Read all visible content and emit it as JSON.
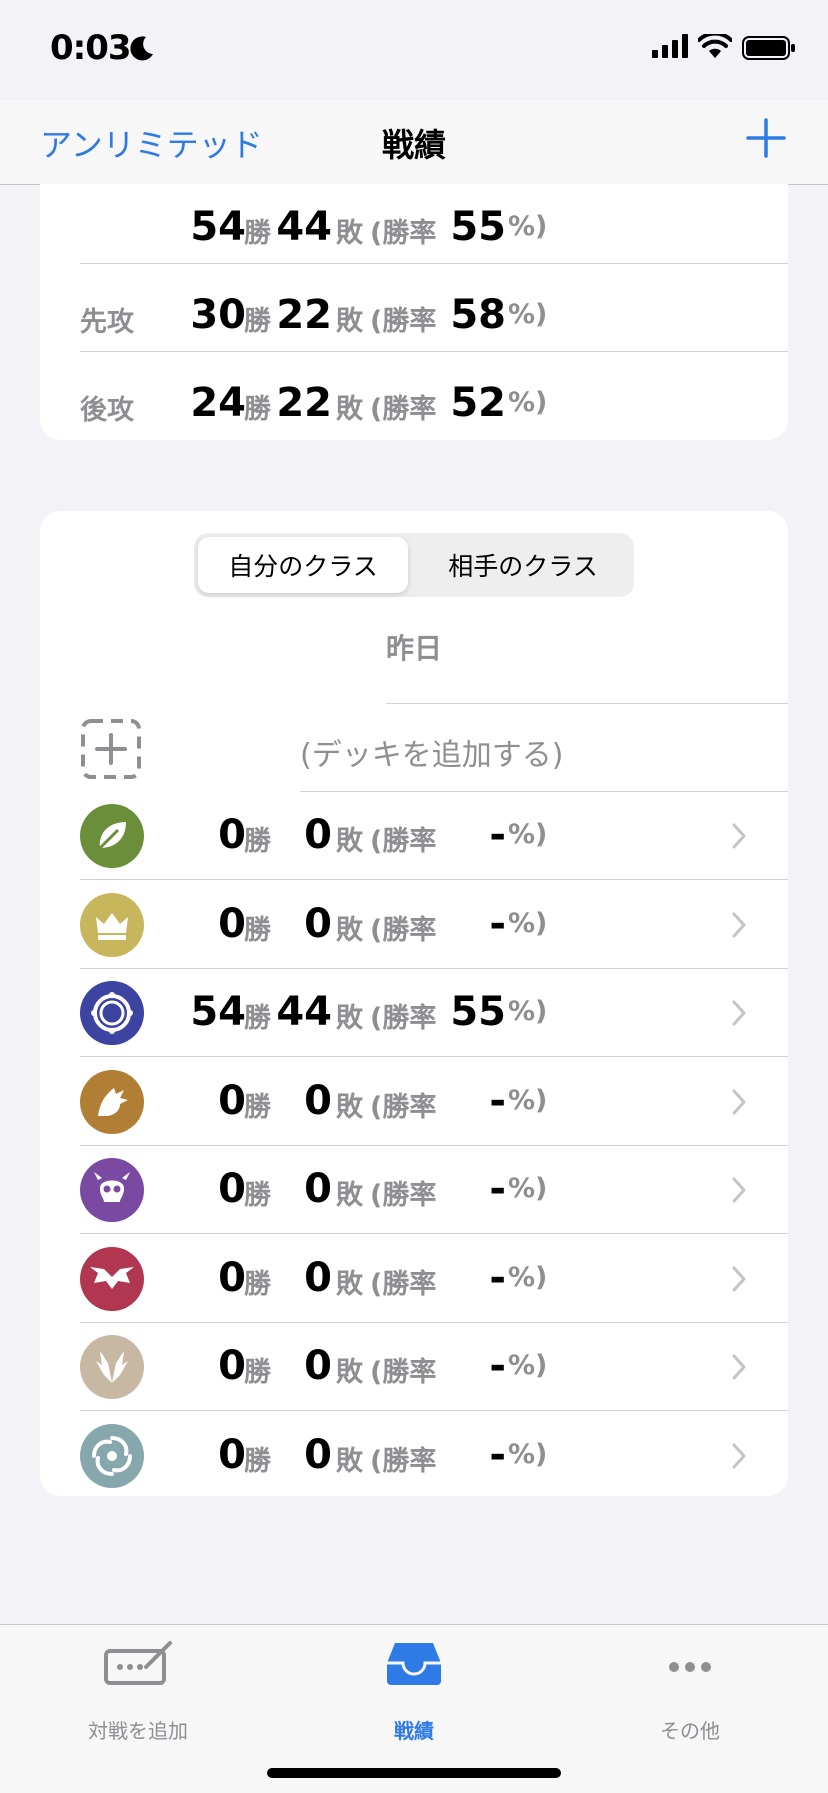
{
  "status": {
    "time": "0:03"
  },
  "nav": {
    "back_label": "アンリミテッド",
    "title": "戦績"
  },
  "summary": {
    "rows": [
      {
        "label": "",
        "wins": "54",
        "win_unit": "勝",
        "losses": "44",
        "loss_unit": "敗",
        "rate_prefix": "(勝率",
        "rate": "55",
        "rate_suffix": "%)"
      },
      {
        "label": "先攻",
        "wins": "30",
        "win_unit": "勝",
        "losses": "22",
        "loss_unit": "敗",
        "rate_prefix": "(勝率",
        "rate": "58",
        "rate_suffix": "%)"
      },
      {
        "label": "後攻",
        "wins": "24",
        "win_unit": "勝",
        "losses": "22",
        "loss_unit": "敗",
        "rate_prefix": "(勝率",
        "rate": "52",
        "rate_suffix": "%)"
      }
    ]
  },
  "segment": {
    "options": [
      "自分のクラス",
      "相手のクラス"
    ],
    "selected": 0
  },
  "section": {
    "header": "昨日",
    "add_deck": "(デッキを追加する)"
  },
  "classes": [
    {
      "icon": "forest-leaf-icon",
      "color": "#6b8e3a",
      "wins": "0",
      "losses": "0",
      "rate": "-"
    },
    {
      "icon": "sword-crown-icon",
      "color": "#c7b65b",
      "wins": "0",
      "losses": "0",
      "rate": "-"
    },
    {
      "icon": "rune-circle-icon",
      "color": "#3d43a0",
      "wins": "54",
      "losses": "44",
      "rate": "55"
    },
    {
      "icon": "dragon-icon",
      "color": "#b07f35",
      "wins": "0",
      "losses": "0",
      "rate": "-"
    },
    {
      "icon": "shadow-skull-icon",
      "color": "#7a4aa3",
      "wins": "0",
      "losses": "0",
      "rate": "-"
    },
    {
      "icon": "blood-bat-icon",
      "color": "#b1364f",
      "wins": "0",
      "losses": "0",
      "rate": "-"
    },
    {
      "icon": "haven-wings-icon",
      "color": "#c8b8a3",
      "wins": "0",
      "losses": "0",
      "rate": "-"
    },
    {
      "icon": "portal-swirl-icon",
      "color": "#86a8ad",
      "wins": "0",
      "losses": "0",
      "rate": "-"
    }
  ],
  "units": {
    "win": "勝",
    "loss": "敗",
    "rate_prefix": "(勝率",
    "rate_suffix": "%)"
  },
  "tabbar": {
    "items": [
      {
        "label": "対戦を追加",
        "active": false
      },
      {
        "label": "戦績",
        "active": true
      },
      {
        "label": "その他",
        "active": false
      }
    ]
  },
  "colors": {
    "accent": "#2f7be6",
    "secondary": "#8e8e93"
  }
}
